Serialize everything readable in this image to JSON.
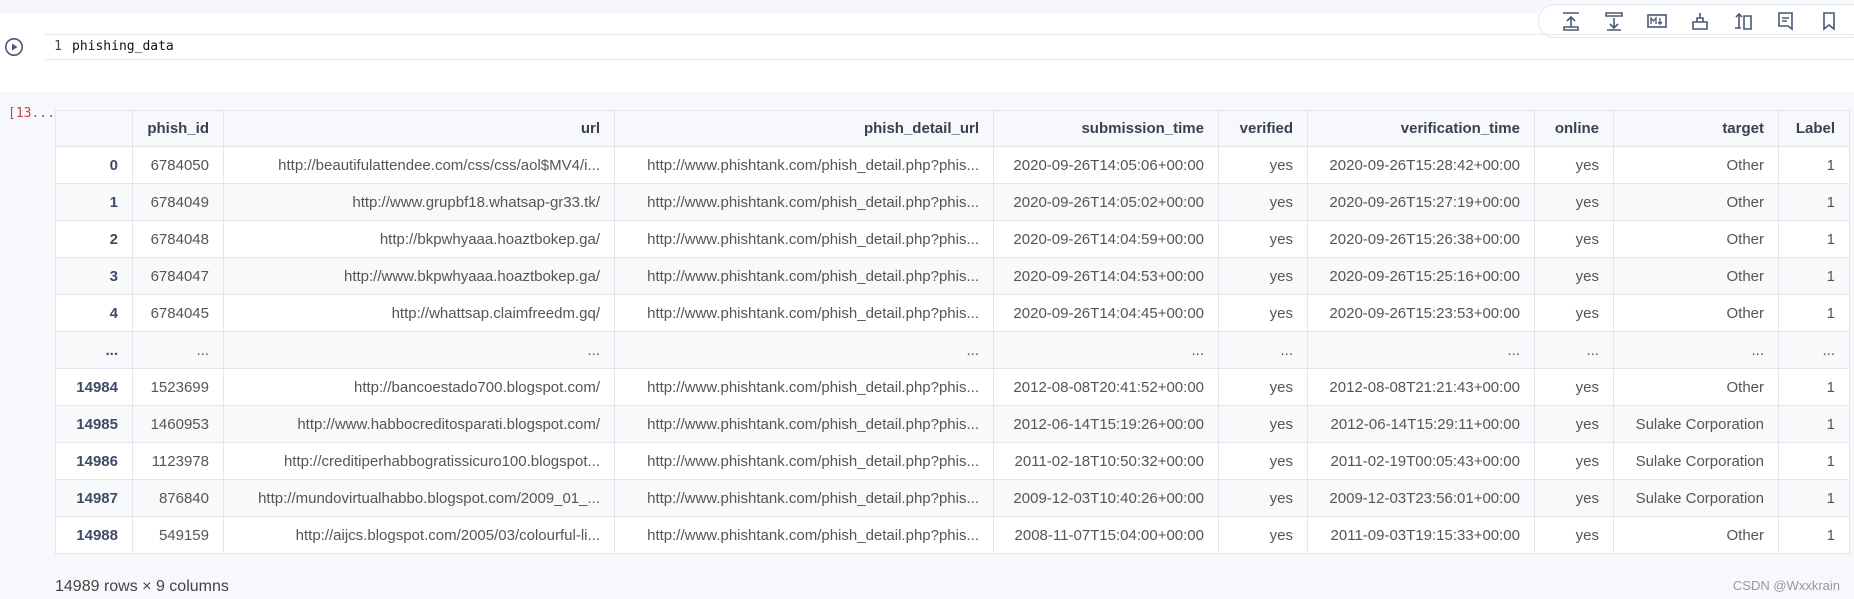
{
  "cell": {
    "line_number": "1",
    "code": "phishing_data",
    "execution_count": "[13..."
  },
  "table": {
    "columns": [
      "",
      "phish_id",
      "url",
      "phish_detail_url",
      "submission_time",
      "verified",
      "verification_time",
      "online",
      "target",
      "Label"
    ],
    "rows": [
      [
        "0",
        "6784050",
        "http://beautifulattendee.com/css/css/aol$MV4/i...",
        "http://www.phishtank.com/phish_detail.php?phis...",
        "2020-09-26T14:05:06+00:00",
        "yes",
        "2020-09-26T15:28:42+00:00",
        "yes",
        "Other",
        "1"
      ],
      [
        "1",
        "6784049",
        "http://www.grupbf18.whatsap-gr33.tk/",
        "http://www.phishtank.com/phish_detail.php?phis...",
        "2020-09-26T14:05:02+00:00",
        "yes",
        "2020-09-26T15:27:19+00:00",
        "yes",
        "Other",
        "1"
      ],
      [
        "2",
        "6784048",
        "http://bkpwhyaaa.hoaztbokep.ga/",
        "http://www.phishtank.com/phish_detail.php?phis...",
        "2020-09-26T14:04:59+00:00",
        "yes",
        "2020-09-26T15:26:38+00:00",
        "yes",
        "Other",
        "1"
      ],
      [
        "3",
        "6784047",
        "http://www.bkpwhyaaa.hoaztbokep.ga/",
        "http://www.phishtank.com/phish_detail.php?phis...",
        "2020-09-26T14:04:53+00:00",
        "yes",
        "2020-09-26T15:25:16+00:00",
        "yes",
        "Other",
        "1"
      ],
      [
        "4",
        "6784045",
        "http://whattsap.claimfreedm.gq/",
        "http://www.phishtank.com/phish_detail.php?phis...",
        "2020-09-26T14:04:45+00:00",
        "yes",
        "2020-09-26T15:23:53+00:00",
        "yes",
        "Other",
        "1"
      ],
      [
        "...",
        "...",
        "...",
        "...",
        "...",
        "...",
        "...",
        "...",
        "...",
        "..."
      ],
      [
        "14984",
        "1523699",
        "http://bancoestado700.blogspot.com/",
        "http://www.phishtank.com/phish_detail.php?phis...",
        "2012-08-08T20:41:52+00:00",
        "yes",
        "2012-08-08T21:21:43+00:00",
        "yes",
        "Other",
        "1"
      ],
      [
        "14985",
        "1460953",
        "http://www.habbocreditosparati.blogspot.com/",
        "http://www.phishtank.com/phish_detail.php?phis...",
        "2012-06-14T15:19:26+00:00",
        "yes",
        "2012-06-14T15:29:11+00:00",
        "yes",
        "Sulake Corporation",
        "1"
      ],
      [
        "14986",
        "1123978",
        "http://creditiperhabbogratissicuro100.blogspot...",
        "http://www.phishtank.com/phish_detail.php?phis...",
        "2011-02-18T10:50:32+00:00",
        "yes",
        "2011-02-19T00:05:43+00:00",
        "yes",
        "Sulake Corporation",
        "1"
      ],
      [
        "14987",
        "876840",
        "http://mundovirtualhabbo.blogspot.com/2009_01_...",
        "http://www.phishtank.com/phish_detail.php?phis...",
        "2009-12-03T10:40:26+00:00",
        "yes",
        "2009-12-03T23:56:01+00:00",
        "yes",
        "Sulake Corporation",
        "1"
      ],
      [
        "14988",
        "549159",
        "http://aijcs.blogspot.com/2005/03/colourful-li...",
        "http://www.phishtank.com/phish_detail.php?phis...",
        "2008-11-07T15:04:00+00:00",
        "yes",
        "2011-09-03T19:15:33+00:00",
        "yes",
        "Other",
        "1"
      ]
    ]
  },
  "summary": "14989 rows × 9 columns",
  "watermark": "CSDN @Wxxkrain",
  "toolbar": {
    "buttons": [
      "insert-cell-above-icon",
      "insert-cell-below-icon",
      "markdown-icon",
      "delete-cell-icon",
      "move-cell-icon",
      "comment-icon",
      "bookmark-icon"
    ]
  },
  "colors": {
    "accent": "#3e4a66",
    "exec_count": "#d14040",
    "background": "#f7f8fb"
  }
}
